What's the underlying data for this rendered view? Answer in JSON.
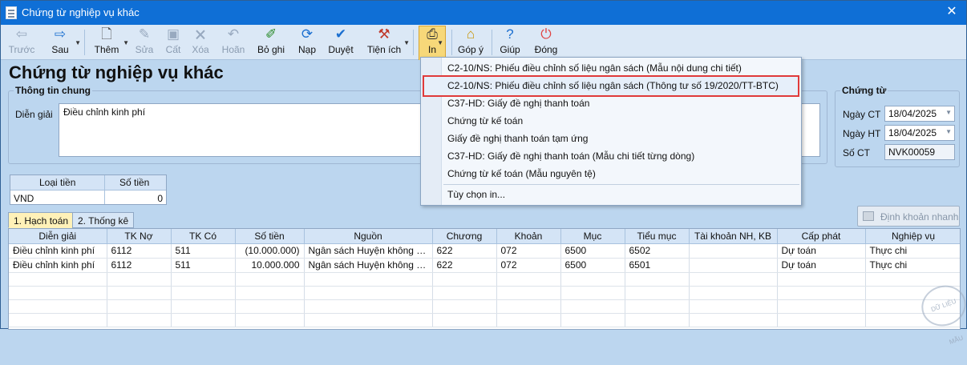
{
  "window": {
    "title": "Chứng từ nghiệp vụ khác"
  },
  "toolbar": {
    "back": "Trước",
    "next": "Sau",
    "add": "Thêm",
    "edit": "Sửa",
    "save": "Cất",
    "delete": "Xóa",
    "undo": "Hoãn",
    "unpost": "Bỏ ghi",
    "load": "Nạp",
    "approve": "Duyệt",
    "utilities": "Tiện ích",
    "print": "In",
    "feedback": "Góp ý",
    "help": "Giúp",
    "close": "Đóng"
  },
  "page_title": "Chứng từ nghiệp vụ khác",
  "general": {
    "legend": "Thông tin chung",
    "dien_giai_label": "Diễn giải",
    "dien_giai_value": "Điều chỉnh kinh phí"
  },
  "voucher": {
    "legend": "Chứng từ",
    "ngay_ct_label": "Ngày CT",
    "ngay_ct_value": "18/04/2025",
    "ngay_ht_label": "Ngày HT",
    "ngay_ht_value": "18/04/2025",
    "so_ct_label": "Số CT",
    "so_ct_value": "NVK00059"
  },
  "currency": {
    "col_type": "Loại tiền",
    "col_amount": "Số tiền",
    "type_value": "VND",
    "amount_value": "0"
  },
  "tabs": [
    {
      "label": "1. Hạch toán"
    },
    {
      "label": "2. Thống kê"
    }
  ],
  "dinh_khoan_button": "Định khoản nhanh",
  "grid": {
    "columns": [
      "Diễn giải",
      "TK Nợ",
      "TK Có",
      "Số tiền",
      "Nguồn",
      "Chương",
      "Khoản",
      "Mục",
      "Tiểu mục",
      "Tài khoản NH, KB",
      "Cấp phát",
      "Nghiệp vụ"
    ],
    "rows": [
      [
        "Điều chỉnh kinh phí",
        "6112",
        "511",
        "(10.000.000)",
        "Ngân sách Huyện không tự c...",
        "622",
        "072",
        "6500",
        "6502",
        "",
        "Dự toán",
        "Thực chi"
      ],
      [
        "Điều chỉnh kinh phí",
        "6112",
        "511",
        "10.000.000",
        "Ngân sách Huyện không tự c...",
        "622",
        "072",
        "6500",
        "6501",
        "",
        "Dự toán",
        "Thực chi"
      ]
    ]
  },
  "print_menu": {
    "items": [
      "C2-10/NS: Phiếu điều chỉnh số liệu ngân sách (Mẫu nội dung chi tiết)",
      "C2-10/NS: Phiếu điều chỉnh số liệu ngân sách (Thông tư số 19/2020/TT-BTC)",
      "C37-HD: Giấy đề nghị thanh toán",
      "Chứng từ kế toán",
      "Giấy đề nghị thanh toán tạm ứng",
      "C37-HD: Giấy đề nghị thanh toán (Mẫu chi tiết từng dòng)",
      "Chứng từ kế toán (Mẫu nguyên tệ)",
      "Tùy chọn in..."
    ],
    "highlighted_index": 1
  },
  "colors": {
    "titlebar": "#0f6fd6",
    "highlight_border": "#e03a3a",
    "background": "#bcd6ef"
  },
  "watermark": "DỮ LIỆU MẪU"
}
